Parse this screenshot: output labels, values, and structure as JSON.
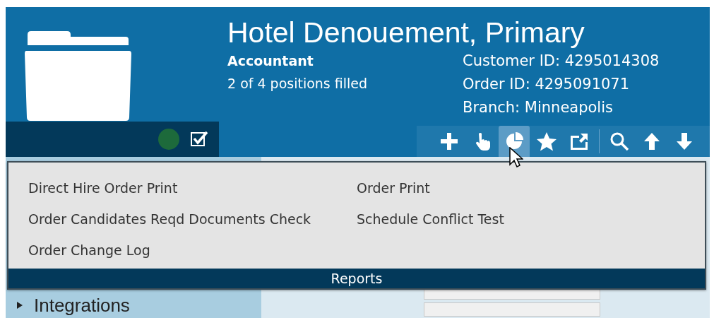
{
  "header": {
    "title": "Hotel Denouement, Primary",
    "position": "Accountant",
    "positions_filled": "2 of 4 positions filled",
    "details": [
      "Customer ID: 4295014308",
      "Order ID: 4295091071",
      "Branch: Minneapolis"
    ],
    "status": {
      "color": "#1d6a3b"
    },
    "checked": true
  },
  "toolbar": [
    {
      "kind": "add",
      "selected": false
    },
    {
      "kind": "hand",
      "selected": false
    },
    {
      "kind": "pie",
      "selected": true
    },
    {
      "kind": "star",
      "selected": false
    },
    {
      "kind": "external",
      "selected": false
    },
    {
      "kind": "search",
      "selected": false
    },
    {
      "kind": "up",
      "selected": false
    },
    {
      "kind": "down",
      "selected": false
    }
  ],
  "reports_menu": {
    "columns": [
      [
        "Direct Hire Order Print",
        "Order Candidates Reqd Documents Check",
        "Order Change Log"
      ],
      [
        "Order Print",
        "Schedule Conflict Test"
      ]
    ],
    "footer": "Reports"
  },
  "sidebar": {
    "items": [
      {
        "label": "Integrations",
        "expanded": false
      }
    ]
  }
}
